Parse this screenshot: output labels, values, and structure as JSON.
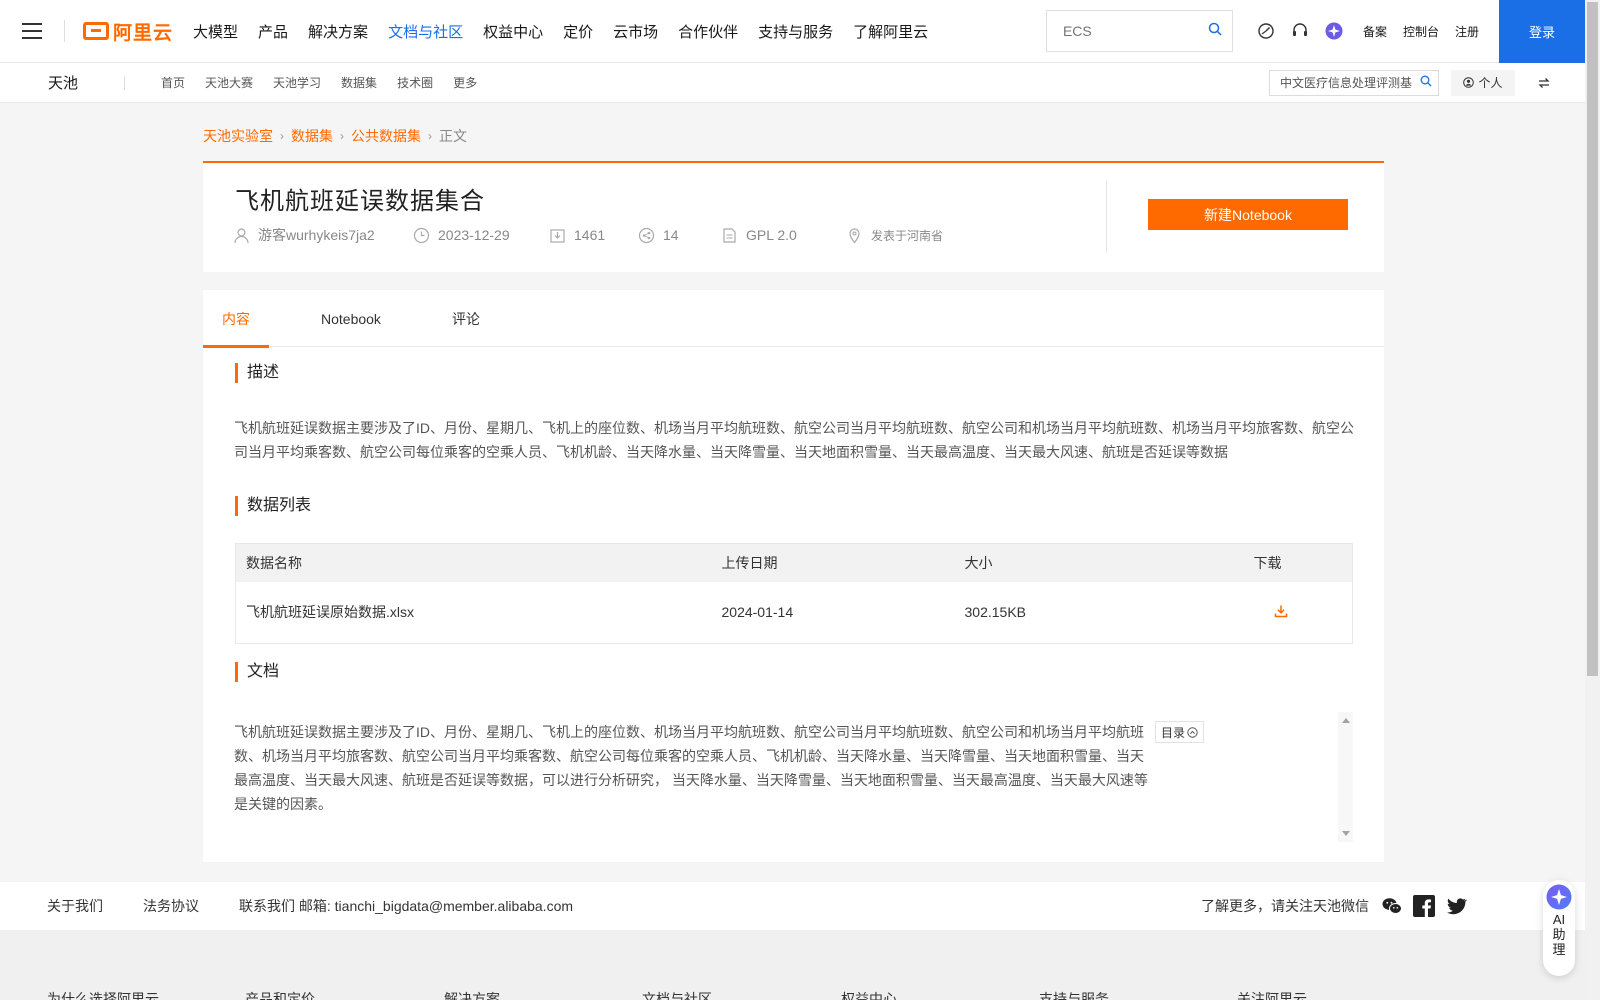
{
  "topnav": {
    "logo_text": "阿里云",
    "items": [
      "大模型",
      "产品",
      "解决方案",
      "文档与社区",
      "权益中心",
      "定价",
      "云市场",
      "合作伙伴",
      "支持与服务",
      "了解阿里云"
    ],
    "active_index": 3,
    "search_placeholder": "ECS",
    "links": [
      "备案",
      "控制台",
      "注册"
    ],
    "login_label": "登录",
    "accent": "#1a6fe6"
  },
  "subnav": {
    "brand": "天池",
    "items": [
      "首页",
      "天池大赛",
      "天池学习",
      "数据集",
      "技术圈",
      "更多"
    ],
    "search_value": "中文医疗信息处理评测基",
    "personal_label": "个人"
  },
  "breadcrumb": [
    "天池实验室",
    "数据集",
    "公共数据集",
    "正文"
  ],
  "dataset": {
    "title": "飞机航班延误数据集合",
    "author": "游客wurhykeis7ja2",
    "date": "2023-12-29",
    "downloads": "1461",
    "shares": "14",
    "license": "GPL 2.0",
    "location": "发表于河南省",
    "new_notebook_label": "新建Notebook",
    "accent": "#ff6a00"
  },
  "tabs": [
    "内容",
    "Notebook",
    "评论"
  ],
  "sections": {
    "desc_title": "描述",
    "desc_text": "飞机航班延误数据主要涉及了ID、月份、星期几、飞机上的座位数、机场当月平均航班数、航空公司当月平均航班数、航空公司和机场当月平均航班数、机场当月平均旅客数、航空公司当月平均乘客数、航空公司每位乘客的空乘人员、飞机机龄、当天降水量、当天降雪量、当天地面积雪量、当天最高温度、当天最大风速、航班是否延误等数据",
    "list_title": "数据列表",
    "doc_title": "文档",
    "doc_text": "飞机航班延误数据主要涉及了ID、月份、星期几、飞机上的座位数、机场当月平均航班数、航空公司当月平均航班数、航空公司和机场当月平均航班数、机场当月平均旅客数、航空公司当月平均乘客数、航空公司每位乘客的空乘人员、飞机机龄、当天降水量、当天降雪量、当天地面积雪量、当天最高温度、当天最大风速、航班是否延误等数据，可以进行分析研究， 当天降水量、当天降雪量、当天地面积雪量、当天最高温度、当天最大风速等是关键的因素。",
    "toc_label": "目录"
  },
  "table": {
    "headers": [
      "数据名称",
      "上传日期",
      "大小",
      "下载"
    ],
    "rows": [
      {
        "name": "飞机航班延误原始数据.xlsx",
        "date": "2024-01-14",
        "size": "302.15KB"
      }
    ]
  },
  "footer": {
    "links": [
      "关于我们",
      "法务协议"
    ],
    "contact": "联系我们 邮箱: tianchi_bigdata@member.alibaba.com",
    "follow": "了解更多，请关注天池微信",
    "bottom_cols": [
      "为什么选择阿里云",
      "产品和定价",
      "解决方案",
      "文档与社区",
      "权益中心",
      "支持与服务",
      "关注阿里云"
    ]
  },
  "ai_assistant": {
    "label": "AI助理"
  }
}
